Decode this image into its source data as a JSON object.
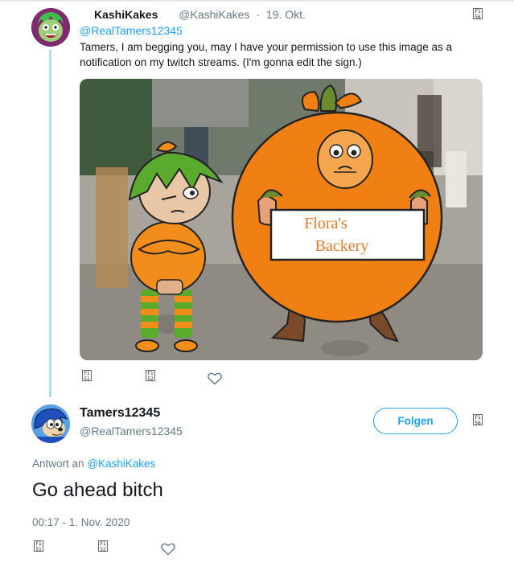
{
  "tweet1": {
    "display_name": "KashiKakes",
    "handle": "@KashiKakes",
    "separator": "·",
    "date": "19. Okt.",
    "reply_to": "@RealTamers12345",
    "text": "Tamers, I am begging you, may I have your permission to use this image as a notification on my twitch streams. (I'm gonna edit the sign.)",
    "image_sign_line1": "Flora's",
    "image_sign_line2": "Backery"
  },
  "tweet2": {
    "display_name": "Tamers12345",
    "handle": "@RealTamers12345",
    "follow_label": "Folgen",
    "reply_prefix": "Antwort an",
    "reply_to": "@KashiKakes",
    "text": "Go ahead bitch",
    "timestamp": "00:17 - 1. Nov. 2020"
  },
  "icons": {
    "menu": "more-menu-icon",
    "reply": "reply-icon",
    "retweet": "retweet-icon",
    "like": "heart-icon"
  },
  "colors": {
    "accent": "#1da1f2",
    "secondary_text": "#657786",
    "thread_line": "#b6dcf5"
  }
}
